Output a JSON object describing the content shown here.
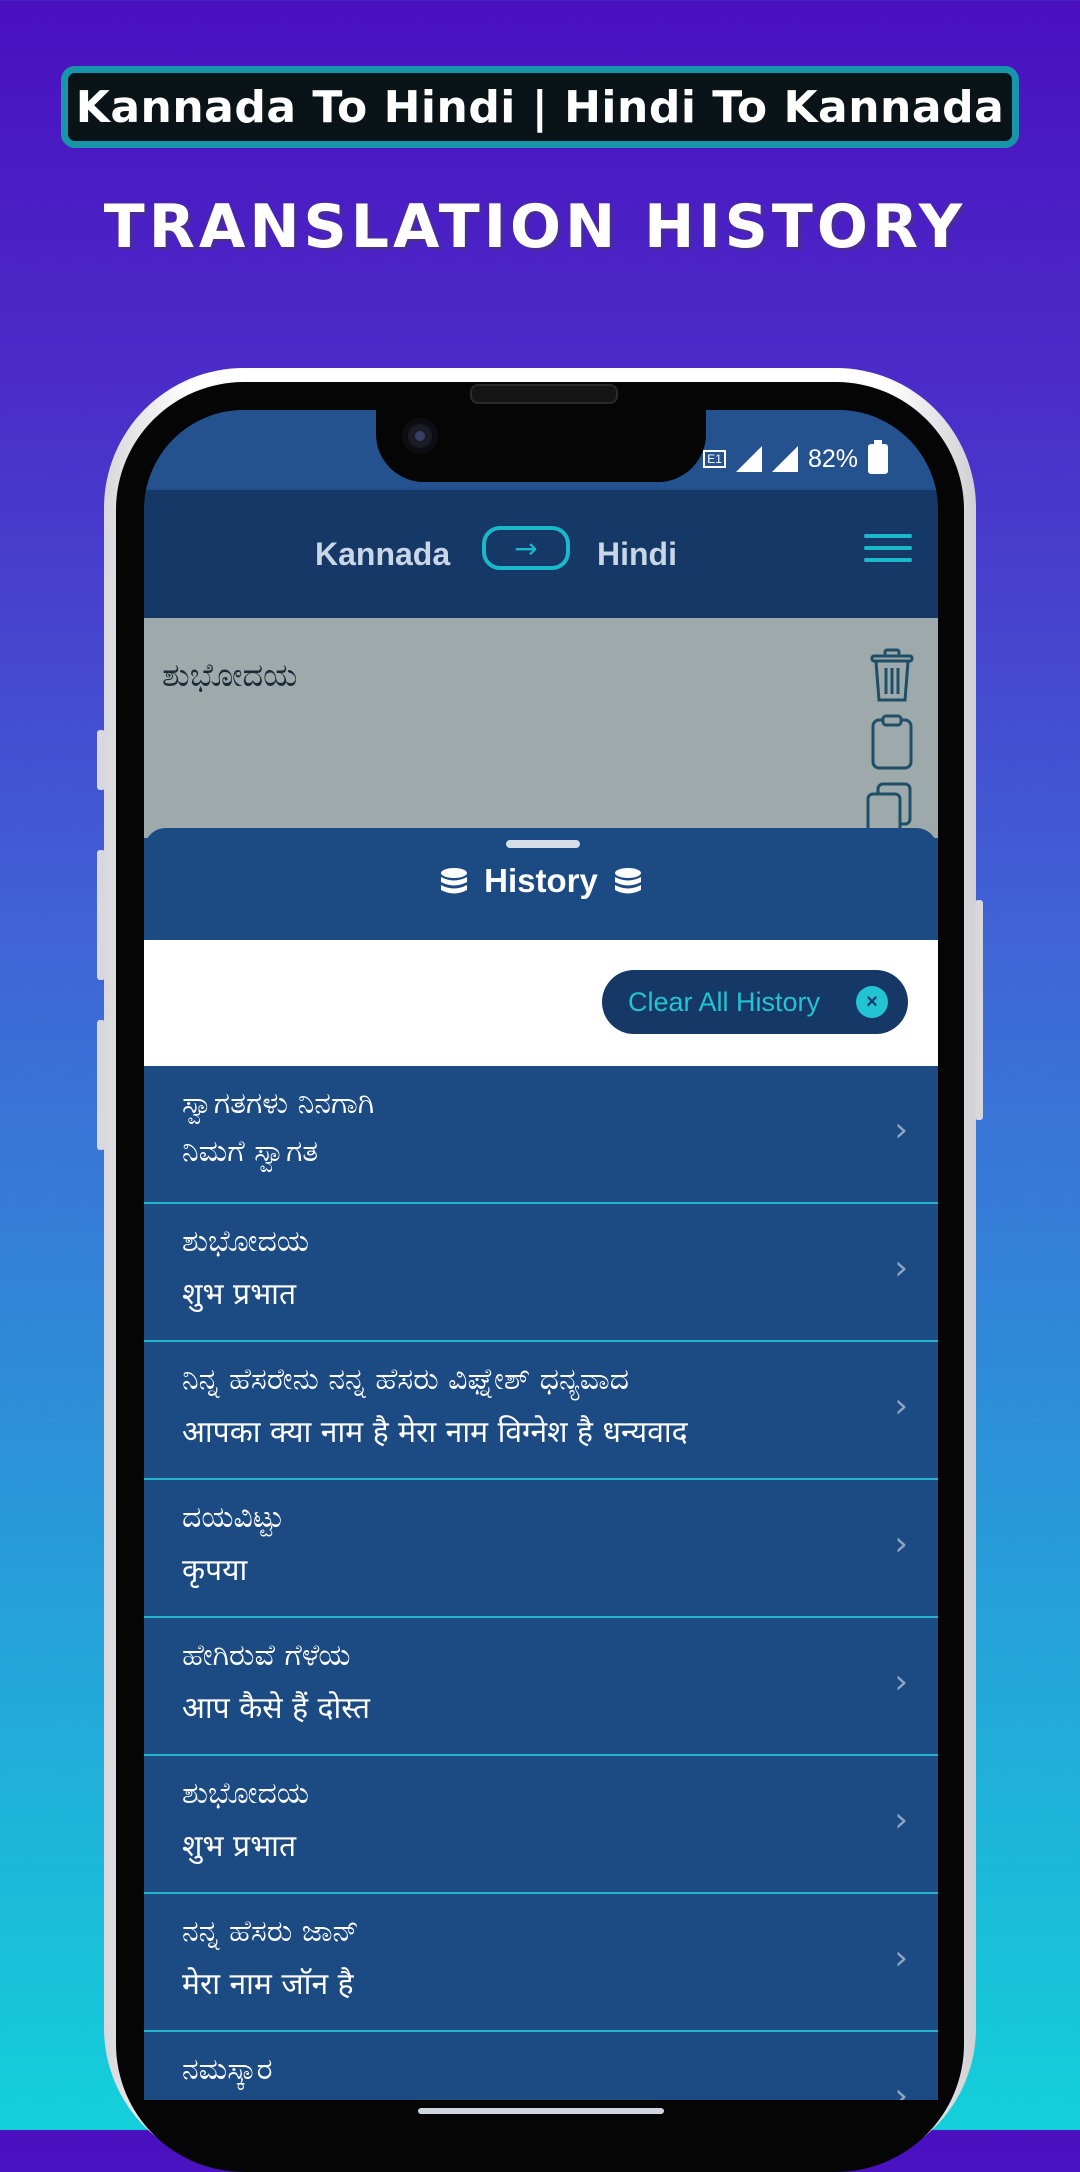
{
  "banner": {
    "title": "Kannada To Hindi | Hindi To Kannada"
  },
  "headline": "TRANSLATION HISTORY",
  "status_bar": {
    "battery": "82%"
  },
  "app_bar": {
    "source_lang": "Kannada",
    "target_lang": "Hindi"
  },
  "input": {
    "text": "ಶುಭೋದಯ"
  },
  "history_sheet": {
    "title": "History",
    "clear_button": "Clear All History",
    "items": [
      {
        "kannada": "ಸ್ವಾಗತಗಳು ನಿನಗಾಗಿ",
        "hindi": "ನಿಮಗೆ ಸ್ವಾಗತ"
      },
      {
        "kannada": "ಶುಭೋದಯ",
        "hindi": "शुभ प्रभात"
      },
      {
        "kannada": "ನಿನ್ನ ಹೆಸರೇನು ನನ್ನ ಹೆಸರು ವಿಘ್ನೇಶ್ ಧನ್ಯವಾದ",
        "hindi": "आपका क्या नाम है मेरा नाम विग्नेश है धन्यवाद"
      },
      {
        "kannada": "ದಯವಿಟ್ಟು",
        "hindi": "कृपया"
      },
      {
        "kannada": "ಹೇಗಿರುವೆ ಗೆಳೆಯ",
        "hindi": "आप कैसे हैं दोस्त"
      },
      {
        "kannada": "ಶುಭೋದಯ",
        "hindi": "शुभ प्रभात"
      },
      {
        "kannada": "ನನ್ನ ಹೆಸರು ಜಾನ್",
        "hindi": "मेरा नाम जॉन है"
      },
      {
        "kannada": "ನಮಸ್ಕಾರ",
        "hindi": ""
      }
    ]
  },
  "colors": {
    "accent": "#1ab8c8",
    "app_bar": "#163866",
    "list_bg": "#1c4a83"
  }
}
